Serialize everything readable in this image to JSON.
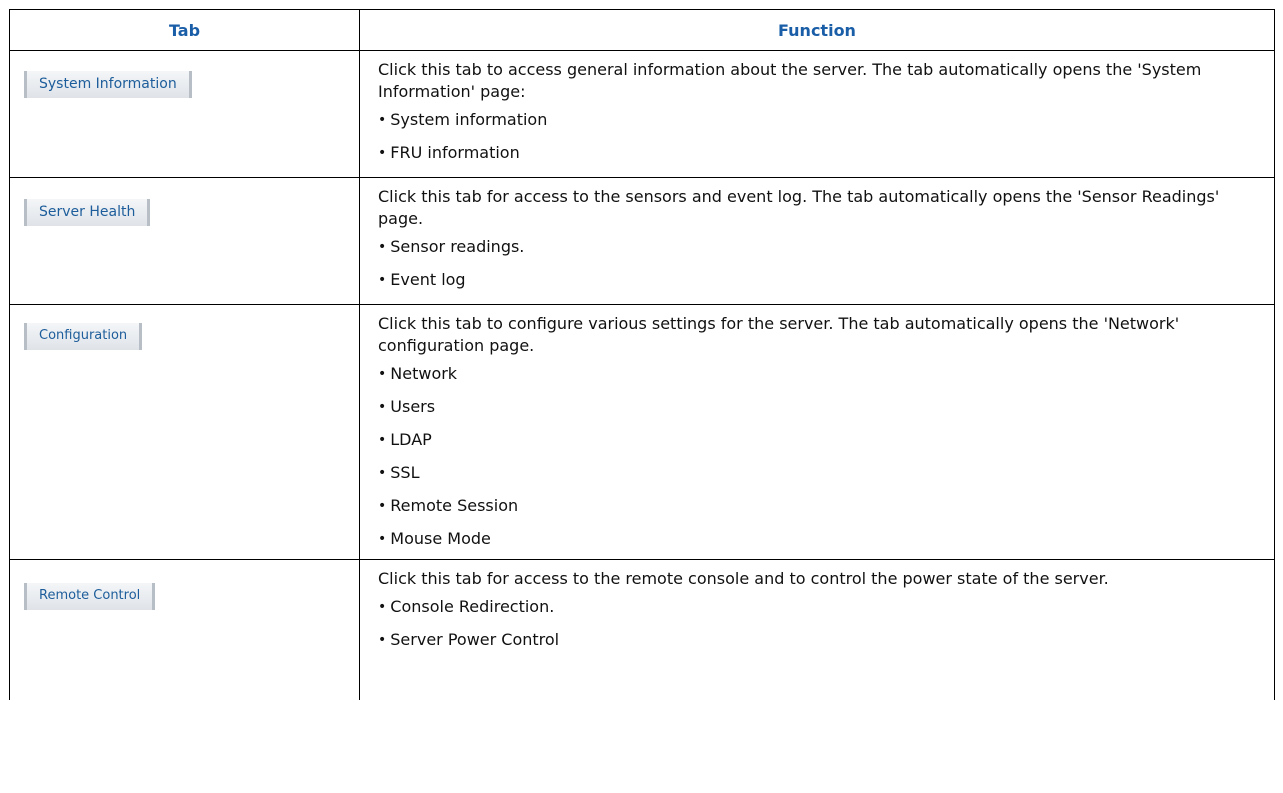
{
  "header": {
    "tab": "Tab",
    "function": "Function"
  },
  "rows": [
    {
      "tab_label": "System Information",
      "description": "Click this tab to access general information about the server. The tab automatically opens the 'System Information' page:",
      "items": [
        "System information",
        "FRU information"
      ]
    },
    {
      "tab_label": "Server Health",
      "description": "Click this tab for access to the sensors and event log. The tab automatically opens the 'Sensor Readings' page.",
      "items": [
        "Sensor readings.",
        "Event log"
      ]
    },
    {
      "tab_label": "Configuration",
      "description": "Click this tab to configure various settings for the server. The tab automatically opens the 'Network' configuration page.",
      "items": [
        "Network",
        "Users",
        "LDAP",
        "SSL",
        "Remote Session",
        "Mouse Mode"
      ]
    },
    {
      "tab_label": "Remote Control",
      "description": "Click this tab for access to the remote console and to control the power state of the server.",
      "items": [
        "Console Redirection.",
        "Server Power Control"
      ]
    }
  ],
  "colors": {
    "header_text": "#1a5ea8",
    "tab_text": "#1d5d9b",
    "border": "#000000"
  }
}
